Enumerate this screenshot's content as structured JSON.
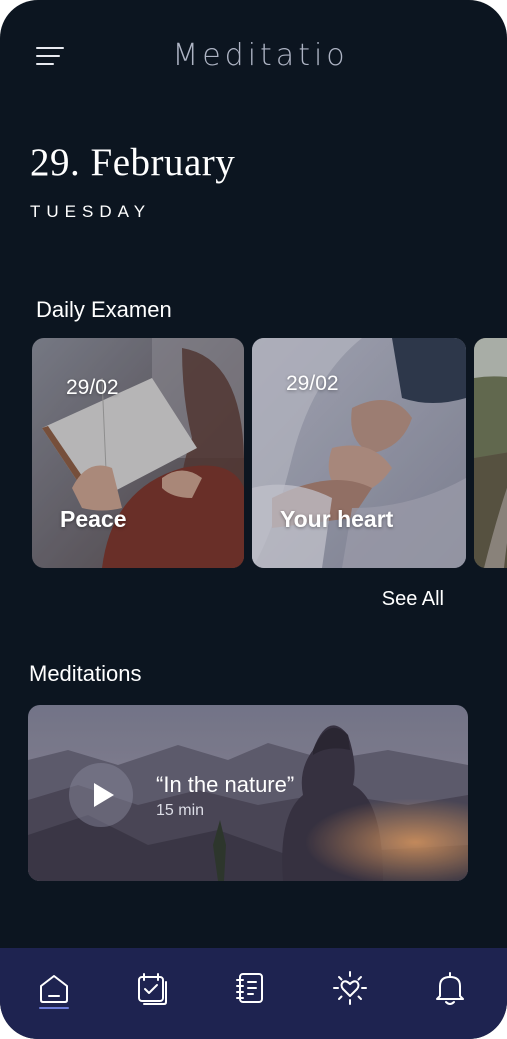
{
  "header": {
    "menu_icon": "hamburger-menu-icon",
    "app_title": "Meditatio"
  },
  "date": {
    "full": "29. February",
    "weekday": "TUESDAY"
  },
  "daily_examen": {
    "title": "Daily Examen",
    "cards": [
      {
        "date": "29/02",
        "title": "Peace",
        "image": "person-reading-book"
      },
      {
        "date": "29/02",
        "title": "Your heart",
        "image": "holding-hands"
      },
      {
        "image": "nature-path"
      }
    ],
    "see_all": "See All"
  },
  "meditations": {
    "title": "Meditations",
    "card": {
      "title": "“In the nature”",
      "duration": "15 min",
      "play_icon": "play-icon",
      "image": "person-on-mountain"
    }
  },
  "bottom_nav": {
    "items": [
      {
        "icon": "home-icon",
        "active": true
      },
      {
        "icon": "calendar-check-icon",
        "active": false
      },
      {
        "icon": "journal-icon",
        "active": false
      },
      {
        "icon": "heart-sun-icon",
        "active": false
      },
      {
        "icon": "bell-icon",
        "active": false
      }
    ]
  },
  "colors": {
    "background": "#0c1520",
    "nav_background": "#1e2350",
    "accent": "#6b7bd8",
    "title_muted": "#aeb4c4"
  }
}
